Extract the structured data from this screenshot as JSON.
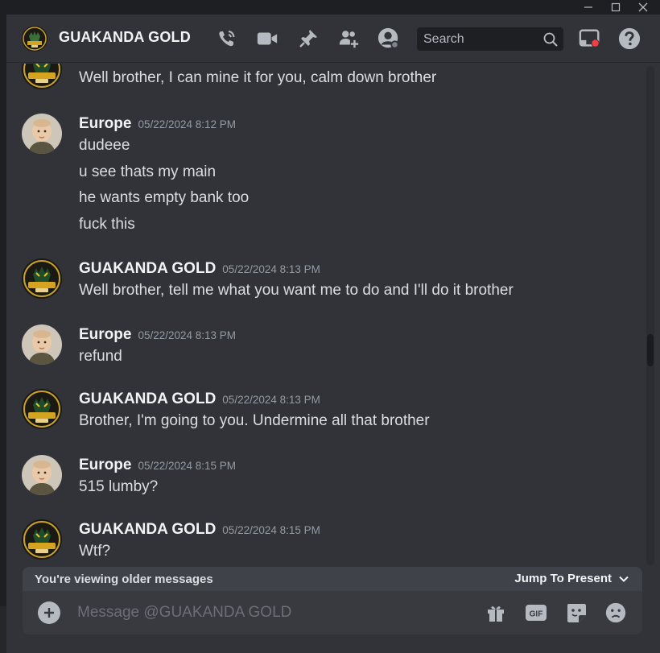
{
  "window_controls": {
    "minimize": "—",
    "maximize": "☐",
    "close": "✕"
  },
  "header": {
    "title": "GUAKANDA GOLD",
    "search_placeholder": "Search",
    "icons": [
      "phone-call-icon",
      "video-camera-icon",
      "pin-icon",
      "add-friend-icon",
      "user-profile-icon",
      "search-icon",
      "inbox-icon",
      "help-icon"
    ]
  },
  "messages": [
    {
      "author": "",
      "timestamp": "",
      "lines": [
        "Well brother, I can mine it for you, calm down brother"
      ],
      "avatar": "guakanda-avatar"
    },
    {
      "author": "Europe",
      "timestamp": "05/22/2024 8:12 PM",
      "lines": [
        "dudeee",
        "u see thats my main",
        "he wants empty bank too",
        "fuck this"
      ],
      "avatar": "europe-avatar"
    },
    {
      "author": "GUAKANDA GOLD",
      "timestamp": "05/22/2024 8:13 PM",
      "lines": [
        "Well brother, tell me what you want me to do and I'll do it brother"
      ],
      "avatar": "guakanda-avatar"
    },
    {
      "author": "Europe",
      "timestamp": "05/22/2024 8:13 PM",
      "lines": [
        "refund"
      ],
      "avatar": "europe-avatar"
    },
    {
      "author": "GUAKANDA GOLD",
      "timestamp": "05/22/2024 8:13 PM",
      "lines": [
        "Brother, I'm going to you. Undermine all that brother"
      ],
      "avatar": "guakanda-avatar"
    },
    {
      "author": "Europe",
      "timestamp": "05/22/2024 8:15 PM",
      "lines": [
        "515 lumby?"
      ],
      "avatar": "europe-avatar"
    },
    {
      "author": "GUAKANDA GOLD",
      "timestamp": "05/22/2024 8:15 PM",
      "lines": [
        "Wtf?"
      ],
      "avatar": "guakanda-avatar"
    }
  ],
  "older_messages_bar": {
    "text": "You're viewing older messages",
    "jump_label": "Jump To Present"
  },
  "composer": {
    "placeholder": "Message @GUAKANDA GOLD",
    "icons": [
      "gift-icon",
      "gif-icon",
      "sticker-icon",
      "emoji-icon"
    ],
    "gif_label": "GIF"
  },
  "colors": {
    "background": "#313338",
    "header_text": "#f2f3f5",
    "message_text": "#dbdee1",
    "timestamp": "#949ba4",
    "notification_dot": "#f23f43"
  }
}
